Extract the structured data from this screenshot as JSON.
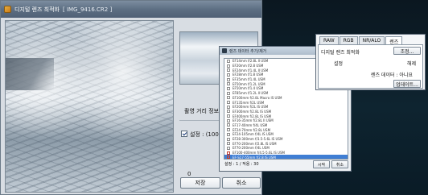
{
  "main_window": {
    "title": "디지털 렌즈 최적화",
    "file": "[ IMG_9416.CR2 ]",
    "section_label": "촬영 거리 정보",
    "checkbox_label": "설정 : (100)",
    "value_zero": "0",
    "save_button": "저장",
    "cancel_button": "취소"
  },
  "lens_dialog": {
    "title": "렌즈 데이터 추가/제거",
    "close": "x",
    "lenses": [
      {
        "name": "EF14mm f/2.8L II USM",
        "flagged": false
      },
      {
        "name": "EF20mm f/2.8 USM",
        "flagged": false
      },
      {
        "name": "EF24mm f/1.4L II USM",
        "flagged": false
      },
      {
        "name": "EF28mm f/1.8 USM",
        "flagged": false
      },
      {
        "name": "EF35mm f/1.4L USM",
        "flagged": false
      },
      {
        "name": "EF50mm f/1.2L USM",
        "flagged": false
      },
      {
        "name": "EF50mm f/1.4 USM",
        "flagged": false
      },
      {
        "name": "EF85mm f/1.2L II USM",
        "flagged": false
      },
      {
        "name": "EF100mm f/2.8L Macro IS USM",
        "flagged": false
      },
      {
        "name": "EF135mm f/2L USM",
        "flagged": false
      },
      {
        "name": "EF200mm f/2L IS USM",
        "flagged": false
      },
      {
        "name": "EF300mm f/2.8L IS USM",
        "flagged": false
      },
      {
        "name": "EF400mm f/2.8L IS USM",
        "flagged": false
      },
      {
        "name": "EF16-35mm f/2.8L II USM",
        "flagged": false
      },
      {
        "name": "EF17-40mm f/4L USM",
        "flagged": false
      },
      {
        "name": "EF24-70mm f/2.8L USM",
        "flagged": false
      },
      {
        "name": "EF24-105mm f/4L IS USM",
        "flagged": false
      },
      {
        "name": "EF28-300mm f/3.5-5.6L IS USM",
        "flagged": false
      },
      {
        "name": "EF70-200mm f/2.8L IS USM",
        "flagged": false
      },
      {
        "name": "EF70-200mm f/4L USM",
        "flagged": false
      },
      {
        "name": "EF100-400mm f/4.5-5.6L IS USM",
        "flagged": true
      },
      {
        "name": "EF-S17-55mm f/2.8 IS USM",
        "flagged": true
      },
      {
        "name": "EF-S18-55mm f/3.5-5.6 IS",
        "flagged": false
      },
      {
        "name": "EF-S55-250mm f/4-5.6 IS",
        "flagged": false
      },
      {
        "name": "EF-S60mm f/2.8 Macro USM",
        "flagged": false
      }
    ],
    "selected_index": 21,
    "footer": "설정 : 1 / 적용 : 30",
    "ok_button": "시작",
    "cancel_button": "취소"
  },
  "tab_panel": {
    "tabs": [
      "RAW",
      "RGB",
      "NR/ALO",
      "렌즈"
    ],
    "active_tab": 3,
    "label1": "디지털 렌즈 최적화",
    "settings_button": "조정...",
    "label2": "설정",
    "value2": "해제",
    "label3": "렌즈 데이터 : 아니요",
    "update_button": "업데이트..."
  },
  "colors": {
    "selection": "#3f7ed4",
    "title_bar": "#5d6f83",
    "background_dark": "#0e2430"
  }
}
